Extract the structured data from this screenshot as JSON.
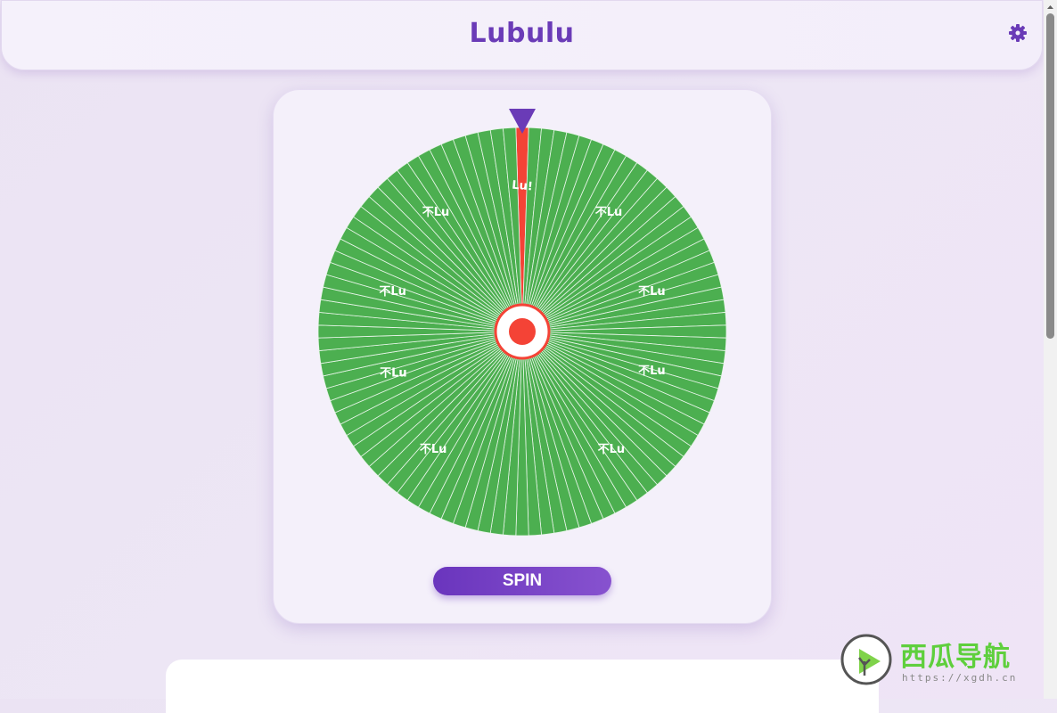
{
  "header": {
    "title": "Lubulu",
    "settings_icon": "gear-icon"
  },
  "wheel": {
    "segment_count": 100,
    "win_label": "Lu!",
    "lose_label": "不Lu",
    "win_color": "#f44336",
    "lose_color": "#4caf50",
    "pointer_color": "#6a3bb7",
    "hub_color": "#f44336"
  },
  "spin_button": {
    "label": "SPIN"
  },
  "watermark": {
    "name": "西瓜导航",
    "url": "https://xgdh.cn"
  },
  "colors": {
    "accent": "#6a3bb7",
    "background": "#ede6f5"
  }
}
